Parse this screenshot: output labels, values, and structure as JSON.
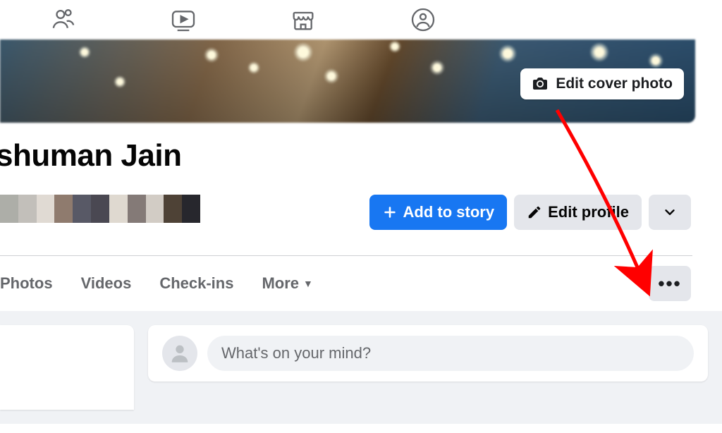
{
  "topNav": {
    "icons": [
      "friends-icon",
      "watch-icon",
      "marketplace-icon",
      "groups-icon"
    ]
  },
  "cover": {
    "editLabel": "Edit cover photo"
  },
  "profile": {
    "name": "shuman Jain"
  },
  "actions": {
    "addStory": "Add to story",
    "editProfile": "Edit profile"
  },
  "tabs": {
    "items": [
      "Photos",
      "Videos",
      "Check-ins"
    ],
    "more": "More"
  },
  "composer": {
    "placeholder": "What's on your mind?"
  },
  "pixelColors": [
    "#adaea8",
    "#c2bfba",
    "#e0dad3",
    "#8f7b6e",
    "#585966",
    "#4a4852",
    "#dfd9d0",
    "#847a77",
    "#d2ccc5",
    "#4e4236",
    "#27272d"
  ]
}
